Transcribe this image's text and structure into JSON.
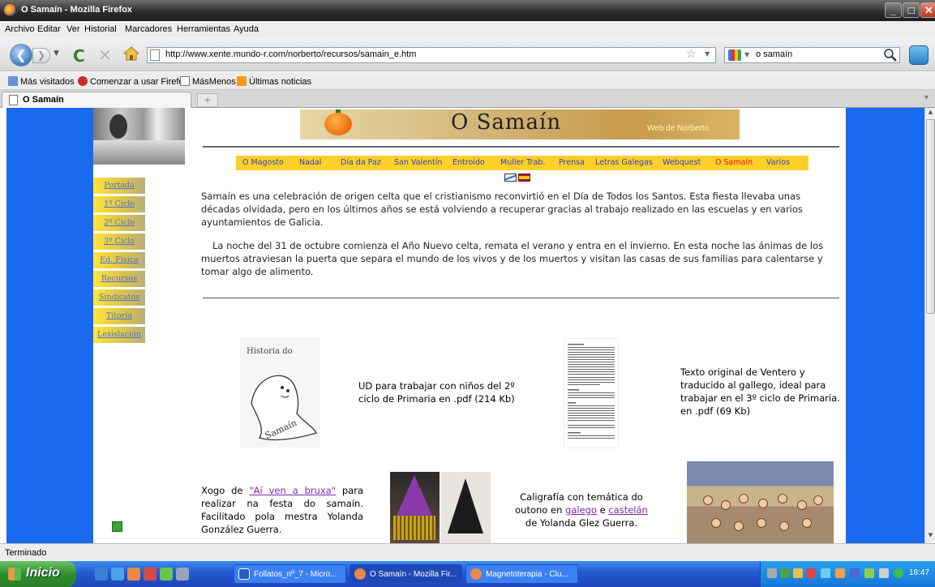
{
  "window": {
    "title": "O Samaín - Mozilla Firefox"
  },
  "menu": [
    "Archivo",
    "Editar",
    "Ver",
    "Historial",
    "Marcadores",
    "Herramientas",
    "Ayuda"
  ],
  "nav": {
    "url": "http://www.xente.mundo-r.com/norberto/recursos/samain_e.htm",
    "search_value": "o samaín"
  },
  "bookmarks": [
    "Más visitados",
    "Comenzar a usar Firefox",
    "MásMenos",
    "Últimas noticias"
  ],
  "tab": {
    "title": "O Samaín"
  },
  "page": {
    "banner_title": "O Samaín",
    "banner_subtitle": "Web de Norberto",
    "side_menu": [
      "Portada",
      "1º Ciclo",
      "2º Ciclo",
      "3º Ciclo",
      "Ed. Física",
      "Recursos",
      "Sindicatos",
      "Titoría",
      "Lexislación"
    ],
    "top_nav": [
      "O Magosto",
      "Nadal",
      "Día da Paz",
      "San Valentín",
      "Entroido",
      "Muller Trab.",
      "Prensa",
      "Letras Galegas",
      "Webquest",
      "O Samaín",
      "Varios"
    ],
    "top_nav_current": "O Samaín",
    "para1": "Samaín es una celebración de origen celta que el cristianismo reconvirtió en el Día de Todos los Santos. Esta fiesta llevaba unas décadas olvidada, pero en los últimos años se está volviendo a recuperar gracias al trabajo realizado en las escuelas y en varios ayuntamientos de Galicia.",
    "para2": "La noche del 31 de octubre comienza el Año Nuevo celta, remata el verano y entra en el invierno. En esta noche las ánimas de los muertos atraviesan la puerta que separa el mundo de los vivos y de los muertos y visitan las casas de sus familias para calentarse y tomar algo de alimento.",
    "thumb1_text": "Historia do",
    "thumb1_ghost": "Samaín",
    "cap1": "UD para trabajar con niños del 2º ciclo de Primaria en .pdf (214 Kb)",
    "cap2": "Texto original de Ventero y traducido al gallego, ideal para trabajar en el 3º ciclo de Primaria. en .pdf (69 Kb)",
    "cap3_pre": "Xogo de ",
    "cap3_link": "\"Aí ven a bruxa\"",
    "cap3_post": " para realizar na festa do samaín. Facilitado pola mestra Yolanda González Guerra.",
    "cap4_pre": "Caligrafía con temática do outono en ",
    "cap4_link1": "galego",
    "cap4_mid": " e ",
    "cap4_link2": "castelán",
    "cap4_post": " de Yolanda Glez Guerra."
  },
  "status": "Terminado",
  "taskbar": {
    "start": "Inicio",
    "tasks": [
      "Follatos_nº_7 - Micro...",
      "O Samaín - Mozilla Fir...",
      "Magnetoterapia - Clu..."
    ],
    "clock": "18:47"
  }
}
